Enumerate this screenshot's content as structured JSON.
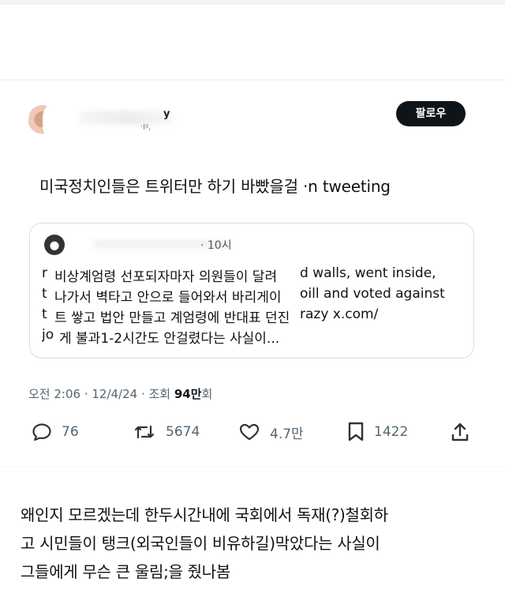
{
  "tweet": {
    "author_name_partial": "y",
    "handle_partial": "·Iᵍ,",
    "follow_label": "팔로우",
    "text": "미국정치인들은 트위터만 하기 바빴을걸 ·n tweeting",
    "quote": {
      "time_partial": "·  10시",
      "lines": [
        {
          "lead": "r",
          "korean": "비상계엄령 선포되자마자 의원들이 달려",
          "english": "d walls, went inside,"
        },
        {
          "lead": "t",
          "korean": "나가서 벽타고 안으로 들어와서 바리게이",
          "english": "oill and voted against"
        },
        {
          "lead": "t",
          "korean": "트 쌓고 법안 만들고 계엄령에 반대표 던진",
          "english": "razy x.com/"
        },
        {
          "lead": "jo",
          "korean": "게 불과1-2시간도 안걸렸다는 사실이...",
          "english": ""
        }
      ]
    },
    "meta": {
      "time_date": "오전 2:06 · 12/4/24 · 조회 ",
      "views_number": "94만",
      "views_suffix": "회"
    },
    "actions": {
      "replies": "76",
      "retweets": "5674",
      "likes": "4.7만",
      "bookmarks": "1422"
    }
  },
  "caption": {
    "lines": [
      "왜인지 모르겠는데 한두시간내에 국회에서 독재(?)철회하",
      "고 시민들이 탱크(외국인들이 비유하길)막았다는 사실이",
      "그들에게 무슨 큰 울림;을 줬나봄"
    ]
  }
}
